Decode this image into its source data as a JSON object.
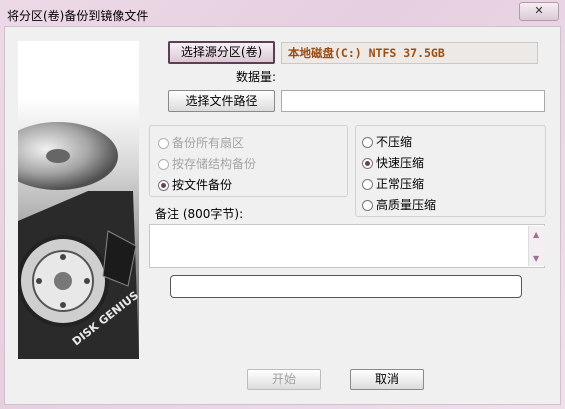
{
  "window": {
    "title": "将分区(卷)备份到镜像文件",
    "close_label": "✕"
  },
  "source": {
    "button_label": "选择源分区(卷)",
    "value": "本地磁盘(C:) NTFS 37.5GB"
  },
  "data_amount_label": "数据量:",
  "target": {
    "button_label": "选择文件路径",
    "path_value": ""
  },
  "backup_modes": {
    "options": [
      {
        "label": "备份所有扇区",
        "selected": false,
        "enabled": false
      },
      {
        "label": "按存储结构备份",
        "selected": false,
        "enabled": false
      },
      {
        "label": "按文件备份",
        "selected": true,
        "enabled": true
      }
    ]
  },
  "compression": {
    "options": [
      {
        "label": "不压缩",
        "selected": false
      },
      {
        "label": "快速压缩",
        "selected": true
      },
      {
        "label": "正常压缩",
        "selected": false
      },
      {
        "label": "高质量压缩",
        "selected": false
      }
    ]
  },
  "note": {
    "label": "备注 (800字节):",
    "value": ""
  },
  "progress": {
    "value": 0
  },
  "buttons": {
    "start_label": "开始",
    "cancel_label": "取消"
  },
  "art": {
    "brand_text": "DISK GENIUS"
  },
  "colors": {
    "accent": "#6a3f5e",
    "source_text": "#9c4e12"
  }
}
